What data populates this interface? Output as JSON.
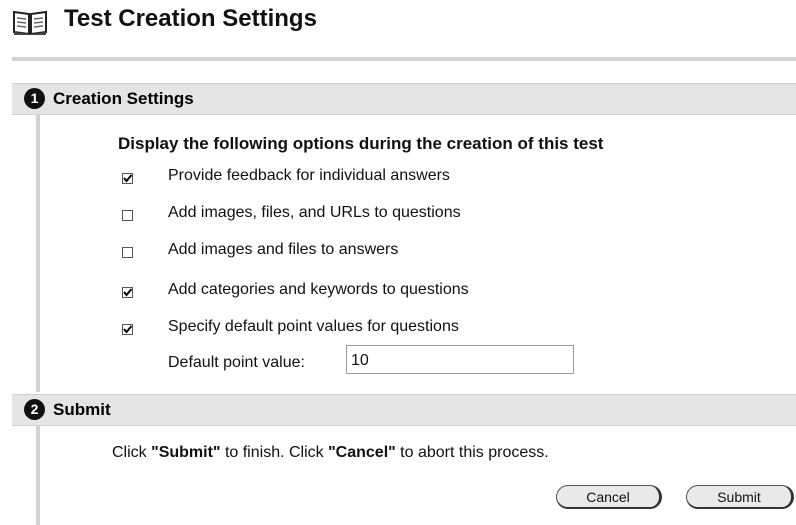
{
  "page": {
    "title": "Test Creation Settings",
    "icon": "book-icon"
  },
  "sections": [
    {
      "number": "1",
      "title": "Creation Settings",
      "icon": "step-1-circle-icon"
    },
    {
      "number": "2",
      "title": "Submit",
      "icon": "step-2-circle-icon"
    }
  ],
  "creation_settings": {
    "instructions": "Display the following options during the creation of this test",
    "options": [
      {
        "label": "Provide feedback for individual answers",
        "checked": true
      },
      {
        "label": "Add images, files, and URLs to questions",
        "checked": false
      },
      {
        "label": "Add images and files to answers",
        "checked": false
      },
      {
        "label": "Add categories and keywords to questions",
        "checked": true
      },
      {
        "label": "Specify default point values for questions",
        "checked": true
      }
    ],
    "default_point_label": "Default point value:",
    "default_point_value": "10"
  },
  "submit": {
    "text_prefix": "Click ",
    "submit_word": "\"Submit\"",
    "text_middle": " to finish. Click ",
    "cancel_word": "\"Cancel\"",
    "text_suffix": " to abort this process.",
    "cancel_label": "Cancel",
    "submit_label": "Submit"
  },
  "colors": {
    "section_bar": "#e5e5e5",
    "rule": "#d3d3d3",
    "check": "#000000"
  }
}
